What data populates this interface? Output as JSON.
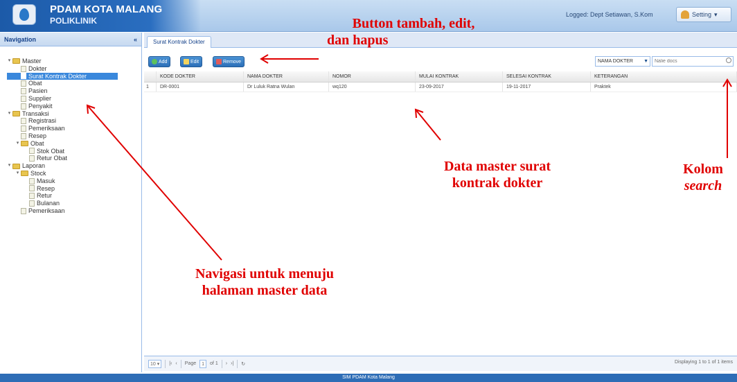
{
  "header": {
    "title": "PDAM KOTA MALANG",
    "subtitle": "POLIKLINIK",
    "logged_in": "Logged: Dept Setiawan, S.Kom",
    "setting_label": "Setting"
  },
  "sidebar": {
    "title": "Navigation",
    "items": [
      {
        "label": "Master",
        "level": 0,
        "type": "folder"
      },
      {
        "label": "Dokter",
        "level": 1,
        "type": "leaf"
      },
      {
        "label": "Surat Kontrak Dokter",
        "level": 1,
        "type": "leaf",
        "selected": true
      },
      {
        "label": "Obat",
        "level": 1,
        "type": "leaf"
      },
      {
        "label": "Pasien",
        "level": 1,
        "type": "leaf"
      },
      {
        "label": "Supplier",
        "level": 1,
        "type": "leaf"
      },
      {
        "label": "Penyakit",
        "level": 1,
        "type": "leaf"
      },
      {
        "label": "Transaksi",
        "level": 0,
        "type": "folder"
      },
      {
        "label": "Registrasi",
        "level": 1,
        "type": "leaf"
      },
      {
        "label": "Pemeriksaan",
        "level": 1,
        "type": "leaf"
      },
      {
        "label": "Resep",
        "level": 1,
        "type": "leaf"
      },
      {
        "label": "Obat",
        "level": 1,
        "type": "folder"
      },
      {
        "label": "Stok Obat",
        "level": 2,
        "type": "leaf"
      },
      {
        "label": "Retur Obat",
        "level": 2,
        "type": "leaf"
      },
      {
        "label": "Laporan",
        "level": 0,
        "type": "folder"
      },
      {
        "label": "Stock",
        "level": 1,
        "type": "folder"
      },
      {
        "label": "Masuk",
        "level": 2,
        "type": "leaf"
      },
      {
        "label": "Resep",
        "level": 2,
        "type": "leaf"
      },
      {
        "label": "Retur",
        "level": 2,
        "type": "leaf"
      },
      {
        "label": "Bulanan",
        "level": 2,
        "type": "leaf"
      },
      {
        "label": "Pemeriksaan",
        "level": 1,
        "type": "leaf"
      }
    ]
  },
  "main": {
    "tab_label": "Surat Kontrak Dokter",
    "toolbar": {
      "add": "Add",
      "edit": "Edit",
      "remove": "Remove"
    },
    "search": {
      "field": "NAMA DOKTER",
      "placeholder": "Nalie docs"
    },
    "grid": {
      "columns": [
        "KODE DOKTER",
        "NAMA DOKTER",
        "NOMOR",
        "MULAI KONTRAK",
        "SELESAI KONTRAK",
        "KETERANGAN"
      ],
      "rows": [
        {
          "num": "1",
          "kode": "DR-0001",
          "nama": "Dr Luluk Ratna Wulan",
          "nomor": "wq120",
          "mulai": "23-09-2017",
          "selesai": "19-11-2017",
          "ket": "Praktek"
        }
      ]
    },
    "pager": {
      "page_size": "10",
      "page_label": "Page",
      "page_value": "1",
      "of_label": "of 1",
      "displaying": "Displaying 1 to 1 of 1 items"
    }
  },
  "footer": {
    "text": "SIM PDAM Kota Malang"
  },
  "annotations": {
    "buttons_line1": "Button tambah, edit,",
    "buttons_line2": "dan hapus",
    "data_line1": "Data master surat",
    "data_line2": "kontrak dokter",
    "search_line1": "Kolom",
    "search_line2": "search",
    "nav_line1": "Navigasi untuk menuju",
    "nav_line2": "halaman master data"
  },
  "colors": {
    "accent": "#2e6db6",
    "annotation": "#e00000",
    "selected": "#3a88dc"
  }
}
